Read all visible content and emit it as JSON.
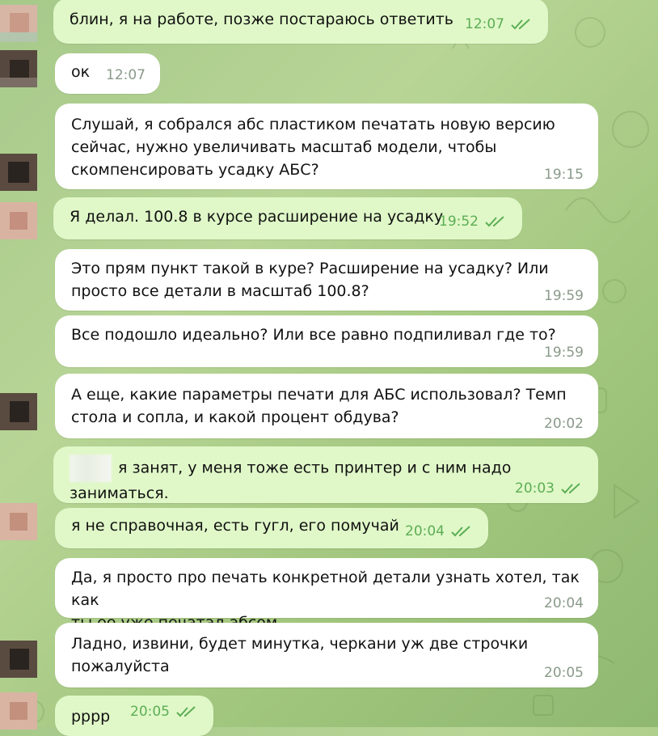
{
  "chat": {
    "messages": [
      {
        "dir": "out",
        "text": "блин, я на работе, позже постараюсь ответить",
        "time": "12:07",
        "read": true
      },
      {
        "dir": "in",
        "text": "ок",
        "time": "12:07"
      },
      {
        "dir": "in",
        "text": "Слушай, я собрался абс пластиком печатать новую версию\nсейчас, нужно увеличивать масштаб модели, чтобы\nскомпенсировать усадку АБС?",
        "time": "19:15"
      },
      {
        "dir": "out",
        "text": "Я делал. 100.8 в курсе расширение на усадку",
        "time": "19:52",
        "read": true
      },
      {
        "dir": "in",
        "text": "Это прям пункт такой в куре? Расширение на усадку? Или\nпросто все детали в масштаб 100.8?",
        "time": "19:59"
      },
      {
        "dir": "in",
        "text": "Все подошло идеально? Или все равно подпиливал где то?",
        "time": "19:59"
      },
      {
        "dir": "in",
        "text": "А еще, какие параметры печати для АБС использовал? Темп\nстола и сопла, и какой процент обдува?",
        "time": "20:02"
      },
      {
        "dir": "out",
        "text": "я занят, у меня тоже есть принтер и с ним надо заниматься.",
        "time": "20:03",
        "read": true
      },
      {
        "dir": "out",
        "text": "я не справочная, есть гугл, его помучай",
        "time": "20:04",
        "read": true
      },
      {
        "dir": "in",
        "text": "Да, я просто про печать конкретной детали узнать хотел, так как\nты ее уже печатал абсом...",
        "time": "20:04"
      },
      {
        "dir": "in",
        "text": "Ладно, извини, будет минутка, черкани уж две строчки\nпожалуйста",
        "time": "20:05"
      },
      {
        "dir": "out",
        "text": "рррр",
        "time": "20:05",
        "read": true
      }
    ]
  },
  "colors": {
    "incoming_bubble": "#ffffff",
    "outgoing_bubble": "#e0f8c8",
    "read_check": "#5cae55",
    "time_text": "#8a9a8a"
  }
}
